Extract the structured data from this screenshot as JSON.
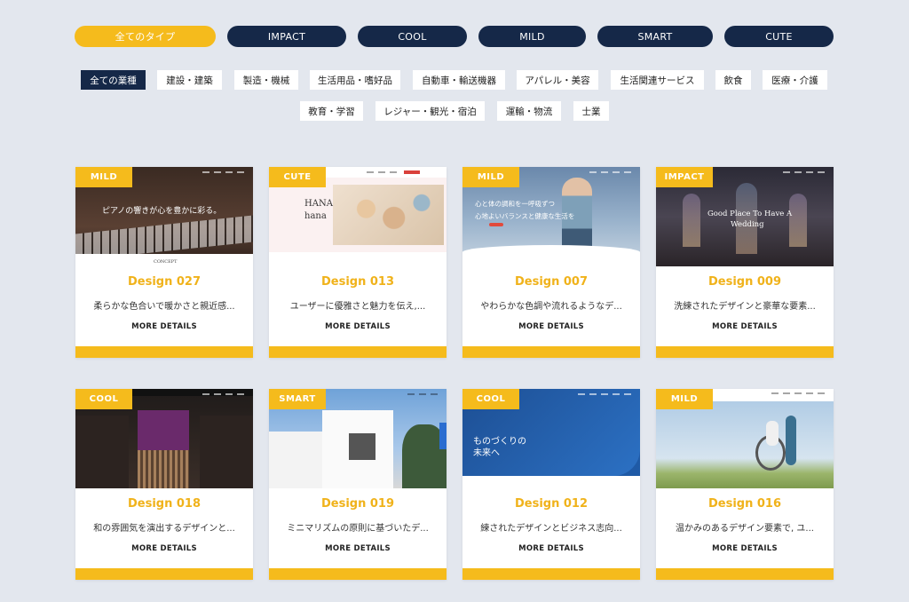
{
  "type_filters": [
    "全てのタイプ",
    "IMPACT",
    "COOL",
    "MILD",
    "SMART",
    "CUTE"
  ],
  "industry_filters_row1": [
    "全ての業種",
    "建設・建築",
    "製造・機械",
    "生活用品・嗜好品",
    "自動車・輸送機器",
    "アパレル・美容",
    "生活関連サービス",
    "飲食",
    "医療・介護"
  ],
  "industry_filters_row2": [
    "教育・学習",
    "レジャー・観光・宿泊",
    "運輸・物流",
    "士業"
  ],
  "more_label": "MORE DETAILS",
  "cards": [
    {
      "badge": "MILD",
      "title": "Design 027",
      "desc": "柔らかな色合いで暖かさと親近感...",
      "thumb_text": "ピアノの響きが心を豊かに彩る。",
      "thumb_sub": "CONCEPT"
    },
    {
      "badge": "CUTE",
      "title": "Design 013",
      "desc": "ユーザーに優雅さと魅力を伝え,...",
      "thumb_text": "HANA",
      "thumb_sub": "hana"
    },
    {
      "badge": "MILD",
      "title": "Design 007",
      "desc": "やわらかな色調や流れるようなデ...",
      "thumb_text": "心と体の調和を一呼吸ずつ",
      "thumb_sub": "心地よいバランスと健康な生活を"
    },
    {
      "badge": "IMPACT",
      "title": "Design 009",
      "desc": "洗練されたデザインと豪華な要素...",
      "thumb_text": "Good Place To Have A",
      "thumb_sub": "Wedding"
    },
    {
      "badge": "COOL",
      "title": "Design 018",
      "desc": "和の雰囲気を演出するデザインと...",
      "thumb_text": "",
      "thumb_sub": ""
    },
    {
      "badge": "SMART",
      "title": "Design 019",
      "desc": "ミニマリズムの原則に基づいたデ...",
      "thumb_text": "",
      "thumb_sub": ""
    },
    {
      "badge": "COOL",
      "title": "Design 012",
      "desc": "練されたデザインとビジネス志向...",
      "thumb_text": "ものづくりの",
      "thumb_sub": "未来へ"
    },
    {
      "badge": "MILD",
      "title": "Design 016",
      "desc": "温かみのあるデザイン要素で, ユ...",
      "thumb_text": "",
      "thumb_sub": ""
    }
  ],
  "colors": {
    "background": "#e3e7ee",
    "navy": "#152848",
    "accent": "#f5bb1c",
    "title": "#f0b21a"
  }
}
